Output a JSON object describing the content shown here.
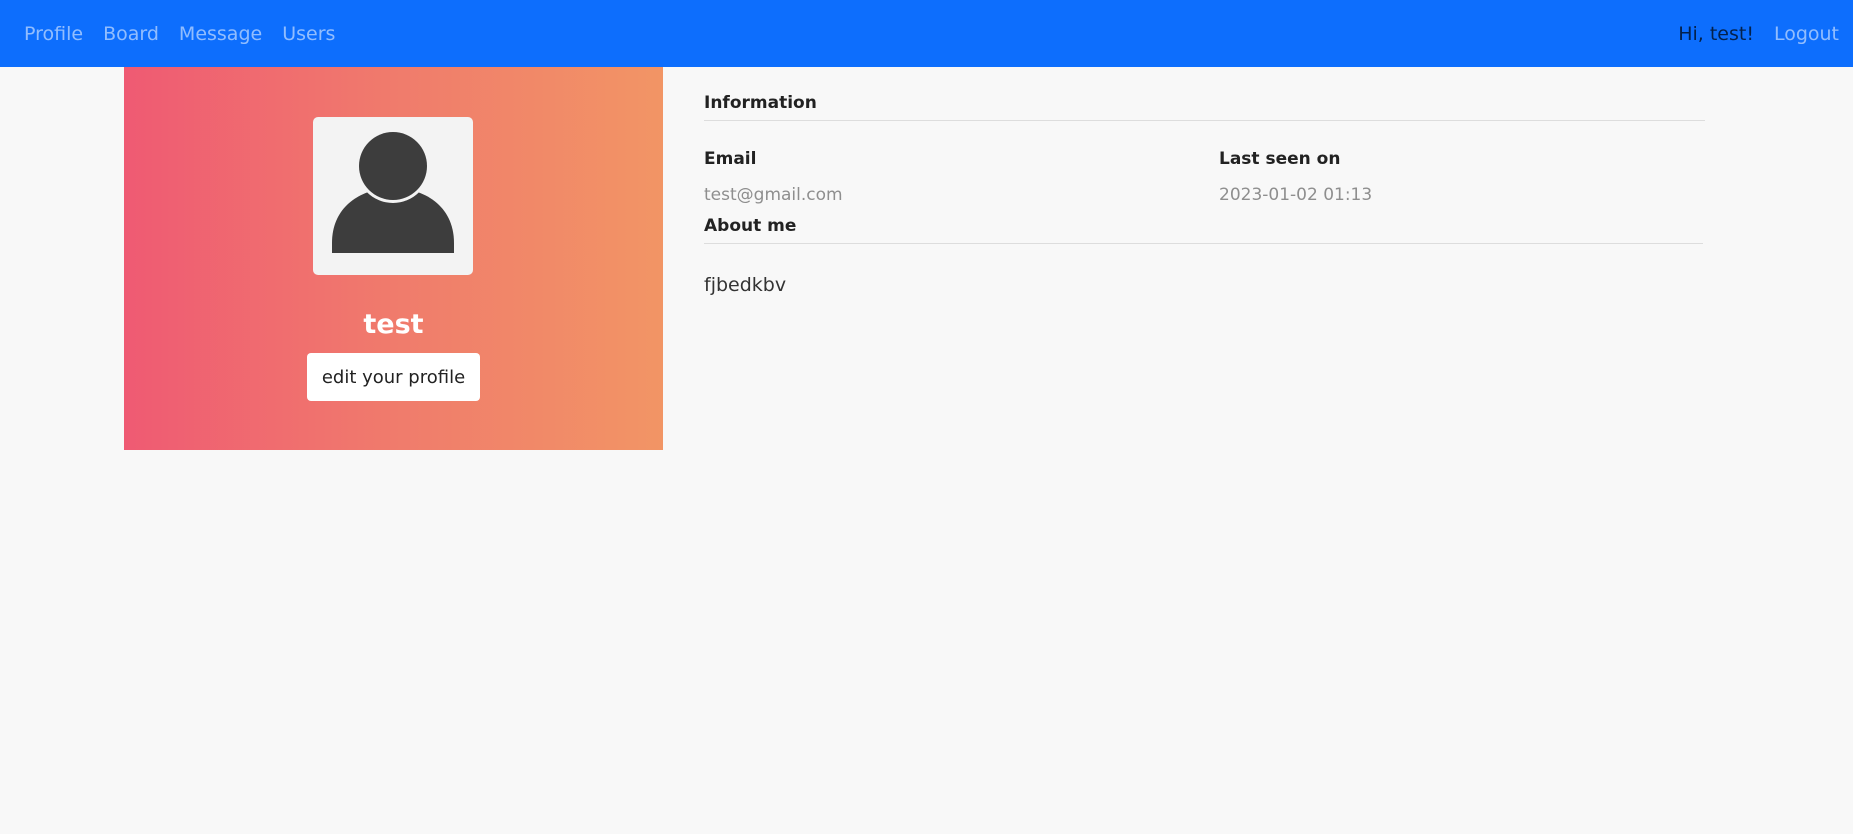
{
  "nav": {
    "links": [
      "Profile",
      "Board",
      "Message",
      "Users"
    ],
    "greeting": "Hi, test!",
    "logout": "Logout",
    "bg_color": "#0d6efd"
  },
  "profile": {
    "avatar_icon": "user-silhouette-icon",
    "username": "test",
    "edit_button": "edit your profile",
    "gradient_colors": [
      "#ef5a73",
      "#f29565"
    ]
  },
  "information": {
    "title": "Information",
    "email_label": "Email",
    "email_value": "test@gmail.com",
    "last_seen_label": "Last seen on",
    "last_seen_value": "2023-01-02 01:13",
    "about_title": "About me",
    "about_text": "fjbedkbv"
  }
}
